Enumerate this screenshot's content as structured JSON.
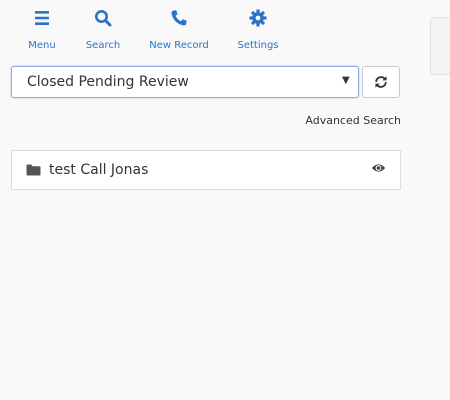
{
  "toolbar": {
    "items": [
      {
        "label": "Menu",
        "icon": "menu-icon"
      },
      {
        "label": "Search",
        "icon": "search-icon"
      },
      {
        "label": "New Record",
        "icon": "phone-icon"
      },
      {
        "label": "Settings",
        "icon": "gear-icon"
      }
    ]
  },
  "filter": {
    "selected": "Closed Pending Review"
  },
  "advanced_search_label": "Advanced Search",
  "records": [
    {
      "title": "test Call Jonas",
      "icon": "folder-icon",
      "action_icon": "eye-icon"
    }
  ],
  "colors": {
    "accent": "#2b72c9",
    "text": "#333333",
    "background": "#f9f9f9"
  }
}
